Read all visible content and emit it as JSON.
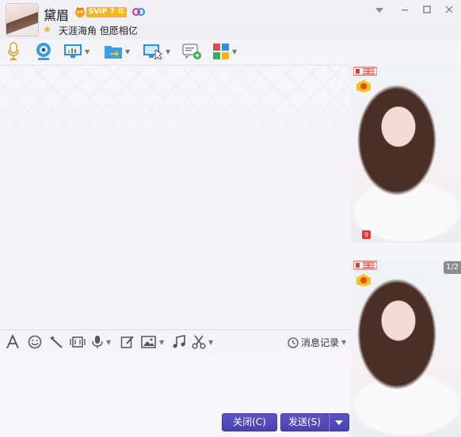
{
  "contact": {
    "name": "黛眉",
    "vip_label": "SVIP 7",
    "vip_year": "年",
    "signature": "天涯海角 但愿相亿"
  },
  "window_controls": [
    "chevron-down-icon",
    "minimize-icon",
    "maximize-icon",
    "close-icon"
  ],
  "toolbar_icons": [
    "microphone-icon",
    "webcam-icon",
    "screen-share-icon",
    "file-transfer-icon",
    "remote-desktop-icon",
    "new-message-icon",
    "apps-icon"
  ],
  "input_toolbar_icons": [
    "font-icon",
    "emoji-icon",
    "magic-wand-icon",
    "screenshot-icon",
    "voice-icon",
    "edit-icon",
    "image-icon",
    "music-icon",
    "scissors-icon"
  ],
  "input_toolbar": {
    "history_label": "消息记录"
  },
  "buttons": {
    "close_label": "关闭(C)",
    "send_label": "发送(S)"
  },
  "photo_panel": {
    "page_indicator": "1/2",
    "level_badge": "9"
  },
  "colors": {
    "accent": "#4a42b0",
    "vip": "#f3b32d",
    "icon_blue": "#2f8fd8"
  }
}
